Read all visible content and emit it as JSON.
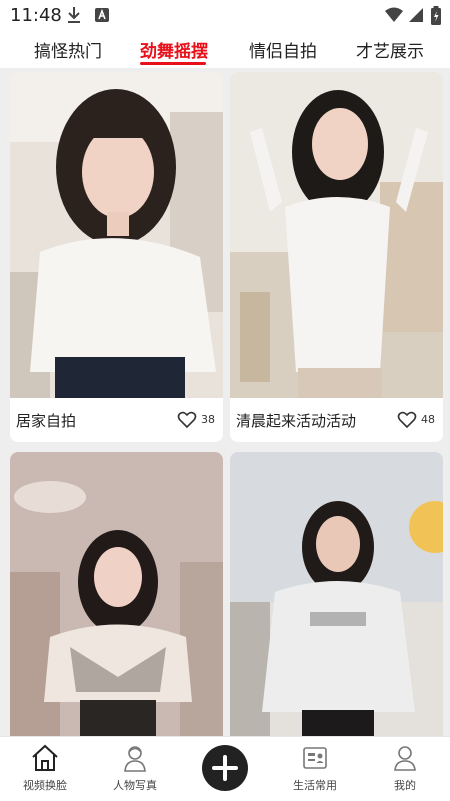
{
  "status_bar": {
    "time": "11:48",
    "icons": [
      "download-icon",
      "a-notification-icon",
      "wifi-icon",
      "signal-icon",
      "battery-icon"
    ]
  },
  "tabs": [
    {
      "label": "搞怪热门",
      "active": false
    },
    {
      "label": "劲舞摇摆",
      "active": true
    },
    {
      "label": "情侣自拍",
      "active": false
    },
    {
      "label": "才艺展示",
      "active": false
    }
  ],
  "accent_color": "#e8101a",
  "cards": [
    {
      "title": "居家自拍",
      "likes": "38",
      "icon": "heart-icon"
    },
    {
      "title": "清晨起来活动活动",
      "likes": "48",
      "icon": "heart-icon"
    },
    {
      "title": "",
      "likes": "",
      "icon": ""
    },
    {
      "title": "",
      "likes": "",
      "icon": ""
    }
  ],
  "bottom_nav": [
    {
      "label": "视频换脸",
      "icon": "home-icon"
    },
    {
      "label": "人物写真",
      "icon": "portrait-icon"
    },
    {
      "label": "",
      "icon": "plus-icon"
    },
    {
      "label": "生活常用",
      "icon": "id-card-icon"
    },
    {
      "label": "我的",
      "icon": "person-icon"
    }
  ]
}
